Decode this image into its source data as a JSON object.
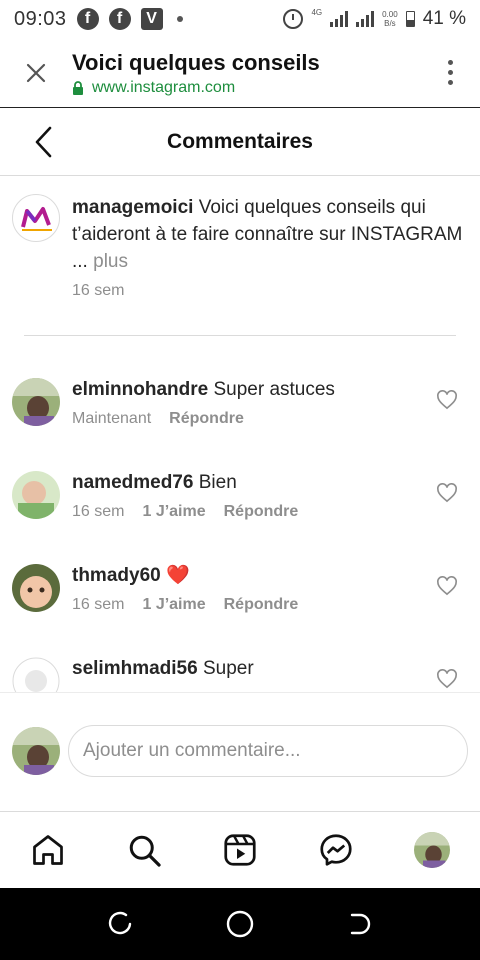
{
  "status_bar": {
    "time": "09:03",
    "network": "4G",
    "speed_value": "0.00",
    "speed_unit": "B/s",
    "battery": "41 %",
    "icons": [
      "facebook-icon",
      "facebook-icon",
      "vimeo-icon",
      "notification-dot-icon",
      "alarm-icon",
      "signal-icon",
      "battery-icon"
    ]
  },
  "browser": {
    "title": "Voici quelques conseils",
    "url": "www.instagram.com",
    "accent_color": "#1e8e3e"
  },
  "header": {
    "title": "Commentaires"
  },
  "caption": {
    "username": "managemoici",
    "text": "Voici quelques conseils qui t’aideront à te faire connaître sur INSTAGRAM ...",
    "more": "plus",
    "time": "16 sem"
  },
  "comments": [
    {
      "username": "elminnohandre",
      "text": "Super astuces",
      "time": "Maintenant",
      "likes": "",
      "reply": "Répondre"
    },
    {
      "username": "namedmed76",
      "text": "Bien",
      "time": "16 sem",
      "likes": "1 J’aime",
      "reply": "Répondre"
    },
    {
      "username": "thmady60",
      "text": "❤️",
      "time": "16 sem",
      "likes": "1 J’aime",
      "reply": "Répondre"
    },
    {
      "username": "selimhmadi56",
      "text": "Super",
      "time": "",
      "likes": "",
      "reply": ""
    }
  ],
  "add_comment": {
    "placeholder": "Ajouter un commentaire..."
  },
  "colors": {
    "text": "#262626",
    "secondary": "#8e8e8e",
    "divider": "#dbdbdb",
    "heart": "#e0245e"
  }
}
